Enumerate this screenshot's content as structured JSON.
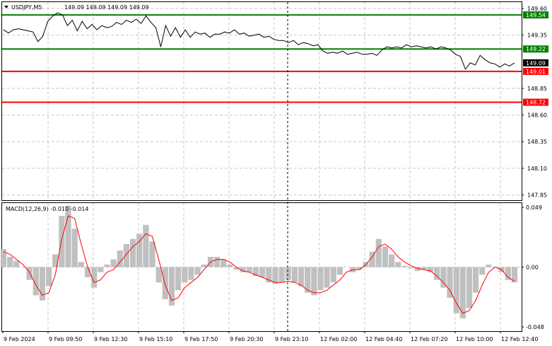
{
  "header": {
    "symbol": "USDJPY,M5",
    "ohlc": "149.09 149.09 149.09 149.09",
    "macd_label": "MACD(12,26,9) -0.010 -0.014"
  },
  "price_axis": {
    "ticks": [
      "149.60",
      "149.35",
      "148.85",
      "148.60",
      "148.35",
      "148.10",
      "147.85"
    ],
    "tick_values": [
      149.6,
      149.35,
      148.85,
      148.6,
      148.35,
      148.1,
      147.85
    ],
    "range": [
      147.8,
      149.66
    ]
  },
  "macd_axis": {
    "ticks": [
      "0.049",
      "0.00",
      "-0.048"
    ],
    "tick_values": [
      0.049,
      0.0,
      -0.048
    ],
    "range": [
      -0.05,
      0.05
    ]
  },
  "time_axis": [
    "9 Feb 2024",
    "9 Feb 09:50",
    "9 Feb 12:30",
    "9 Feb 15:10",
    "9 Feb 17:50",
    "9 Feb 20:30",
    "9 Feb 23:10",
    "12 Feb 02:00",
    "12 Feb 04:40",
    "12 Feb 07:20",
    "12 Feb 10:00",
    "12 Feb 12:40"
  ],
  "levels": [
    {
      "value": 149.54,
      "label": "149.54",
      "color": "#008000"
    },
    {
      "value": 149.22,
      "label": "149.22",
      "color": "#008000"
    },
    {
      "value": 149.01,
      "label": "149.01",
      "color": "#ff0000"
    },
    {
      "value": 148.72,
      "label": "148.72",
      "color": "#ff0000"
    }
  ],
  "current_price": {
    "value": 149.09,
    "label": "149.09"
  },
  "colors": {
    "price_line": "#000000",
    "grid": "#c8c8c8",
    "histogram": "#c0c0c0",
    "signal": "#ff0000",
    "current_bg": "#000000"
  },
  "chart_data": {
    "type": "line",
    "title": "USDJPY,M5",
    "xlabel": "",
    "ylabel": "",
    "ylim": [
      147.8,
      149.66
    ],
    "grid": true,
    "series": [
      {
        "name": "USDJPY",
        "values": [
          149.4,
          149.37,
          149.4,
          149.41,
          149.4,
          149.39,
          149.38,
          149.29,
          149.34,
          149.48,
          149.53,
          149.56,
          149.54,
          149.44,
          149.49,
          149.39,
          149.48,
          149.41,
          149.45,
          149.4,
          149.44,
          149.42,
          149.43,
          149.47,
          149.45,
          149.49,
          149.47,
          149.5,
          149.46,
          149.53,
          149.47,
          149.42,
          149.24,
          149.44,
          149.34,
          149.42,
          149.33,
          149.4,
          149.33,
          149.38,
          149.36,
          149.37,
          149.33,
          149.36,
          149.36,
          149.38,
          149.37,
          149.4,
          149.36,
          149.37,
          149.34,
          149.35,
          149.36,
          149.33,
          149.34,
          149.31,
          149.3,
          149.3,
          149.28,
          149.3,
          149.26,
          149.28,
          149.27,
          149.25,
          149.26,
          149.2,
          149.18,
          149.19,
          149.18,
          149.2,
          149.17,
          149.18,
          149.19,
          149.17,
          149.17,
          149.18,
          149.16,
          149.21,
          149.24,
          149.23,
          149.24,
          149.23,
          149.26,
          149.24,
          149.25,
          149.24,
          149.23,
          149.24,
          149.22,
          149.24,
          149.23,
          149.21,
          149.17,
          149.15,
          149.03,
          149.09,
          149.07,
          149.16,
          149.12,
          149.09,
          149.08,
          149.05,
          149.08,
          149.06,
          149.09
        ]
      },
      {
        "name": "MACD(12,26,9)",
        "values": [
          0.014,
          0.008,
          0.005,
          0.0,
          -0.01,
          -0.022,
          -0.026,
          -0.015,
          0.01,
          0.04,
          0.048,
          0.03,
          0.004,
          -0.008,
          -0.016,
          -0.004,
          0.002,
          0.006,
          0.013,
          0.018,
          0.022,
          0.026,
          0.033,
          0.02,
          -0.012,
          -0.025,
          -0.03,
          -0.018,
          -0.012,
          -0.01,
          -0.006,
          0.002,
          0.008,
          0.008,
          0.006,
          0.002,
          -0.002,
          -0.004,
          -0.004,
          -0.007,
          -0.008,
          -0.012,
          -0.013,
          -0.012,
          -0.01,
          -0.012,
          -0.015,
          -0.02,
          -0.022,
          -0.018,
          -0.016,
          -0.012,
          -0.006,
          0.0,
          -0.004,
          -0.002,
          0.004,
          0.012,
          0.022,
          0.016,
          0.01,
          0.004,
          0.001,
          -0.001,
          -0.003,
          -0.002,
          -0.004,
          -0.01,
          -0.016,
          -0.024,
          -0.036,
          -0.04,
          -0.032,
          -0.02,
          -0.006,
          0.002,
          0.0,
          -0.004,
          -0.01,
          -0.012
        ]
      },
      {
        "name": "Signal",
        "values": [
          0.012,
          0.01,
          0.006,
          0.002,
          -0.004,
          -0.014,
          -0.022,
          -0.02,
          -0.006,
          0.022,
          0.04,
          0.038,
          0.018,
          0.0,
          -0.012,
          -0.01,
          -0.004,
          -0.002,
          0.004,
          0.01,
          0.016,
          0.02,
          0.026,
          0.024,
          0.006,
          -0.014,
          -0.026,
          -0.024,
          -0.016,
          -0.012,
          -0.008,
          -0.002,
          0.004,
          0.006,
          0.006,
          0.004,
          0.0,
          -0.003,
          -0.004,
          -0.006,
          -0.008,
          -0.01,
          -0.012,
          -0.012,
          -0.011,
          -0.012,
          -0.014,
          -0.018,
          -0.02,
          -0.02,
          -0.018,
          -0.014,
          -0.01,
          -0.004,
          -0.002,
          -0.002,
          0.002,
          0.008,
          0.016,
          0.018,
          0.014,
          0.008,
          0.004,
          0.001,
          -0.001,
          -0.002,
          -0.003,
          -0.007,
          -0.012,
          -0.018,
          -0.028,
          -0.036,
          -0.034,
          -0.026,
          -0.014,
          -0.004,
          0.0,
          -0.002,
          -0.008,
          -0.011
        ]
      }
    ]
  }
}
